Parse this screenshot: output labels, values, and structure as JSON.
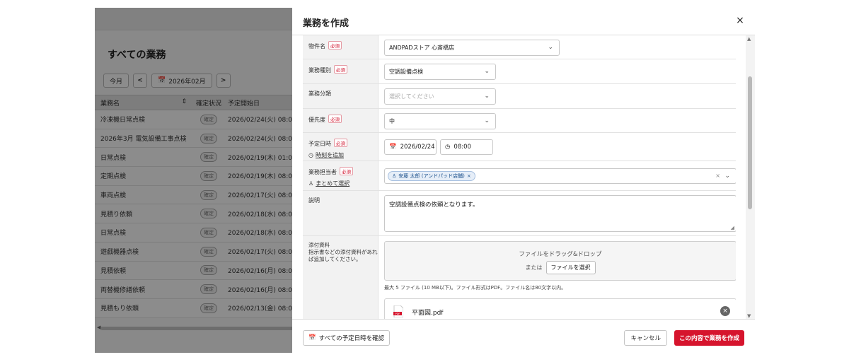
{
  "background": {
    "page_title": "すべての業務",
    "today_label": "今月",
    "prev_label": "<",
    "next_label": ">",
    "month_value": "2026年02月",
    "headers": {
      "name": "業務名",
      "status": "確定状況",
      "start": "予定開始日"
    },
    "rows": [
      {
        "name": "冷凍機日常点検",
        "status": "確定",
        "start": "2026/02/24(火) 08:0"
      },
      {
        "name": "2026年3月 電気設備工事点検",
        "status": "確定",
        "start": "2026/02/24(火) 08:0"
      },
      {
        "name": "日常点検",
        "status": "確定",
        "start": "2026/02/19(木) 01:0"
      },
      {
        "name": "定期点検",
        "status": "確定",
        "start": "2026/02/19(木) 08:0"
      },
      {
        "name": "車両点検",
        "status": "確定",
        "start": "2026/02/17(火) 08:0"
      },
      {
        "name": "見積り依頼",
        "status": "確定",
        "start": "2026/02/18(水) 08:0"
      },
      {
        "name": "日常点検",
        "status": "確定",
        "start": "2026/02/18(水) 08:0"
      },
      {
        "name": "遊戯機器点検",
        "status": "確定",
        "start": "2026/02/17(火) 08:0"
      },
      {
        "name": "見積依頼",
        "status": "確定",
        "start": "2026/02/16(月) 08:0"
      },
      {
        "name": "両替機修繕依頼",
        "status": "確定",
        "start": "2026/02/16(月) 08:0"
      },
      {
        "name": "見積もり依頼",
        "status": "確定",
        "start": "2026/02/13(金) 08:0"
      }
    ]
  },
  "modal": {
    "title": "業務を作成",
    "close_label": "×",
    "required_label": "必須",
    "fields": {
      "property": {
        "label": "物件名",
        "value": "ANDPADストア 心斎橋店"
      },
      "work_type": {
        "label": "業務種別",
        "value": "空調設備点検"
      },
      "work_category": {
        "label": "業務分類",
        "placeholder": "選択してください"
      },
      "priority": {
        "label": "優先度",
        "value": "中"
      },
      "schedule": {
        "label": "予定日時",
        "add_time_link": "時刻を追加",
        "date": "2026/02/24",
        "time": "08:00"
      },
      "assignee": {
        "label": "業務担当者",
        "bulk_select_link": "まとめて選択",
        "chip": "安藤 太郎 (アンドパッド店舗)",
        "clear": "×"
      },
      "description": {
        "label": "説明",
        "value": "空調設備点検の依頼となります。"
      },
      "attachments": {
        "label": "添付資料",
        "label_note": "指示書などの添付資料があれば追加してください。",
        "drop_text": "ファイルをドラッグ&ドロップ",
        "or_text": "または",
        "choose_button": "ファイルを選択",
        "hint": "最大 5 ファイル (10 MB以下)。ファイル形式はPDF。ファイル名は80文字以内。",
        "file_name": "平面図.pdf",
        "file_type": "PDF"
      }
    },
    "footer": {
      "check_schedule": "すべての予定日時を確認",
      "cancel": "キャンセル",
      "submit": "この内容で業務を作成"
    }
  },
  "colors": {
    "primary": "#d6142d",
    "required": "#d0102a",
    "chip_text": "#1a4f8b"
  },
  "icons": [
    "calendar-icon",
    "clock-icon",
    "person-icon",
    "pdf-file-icon",
    "chevron-down-icon",
    "close-icon"
  ]
}
